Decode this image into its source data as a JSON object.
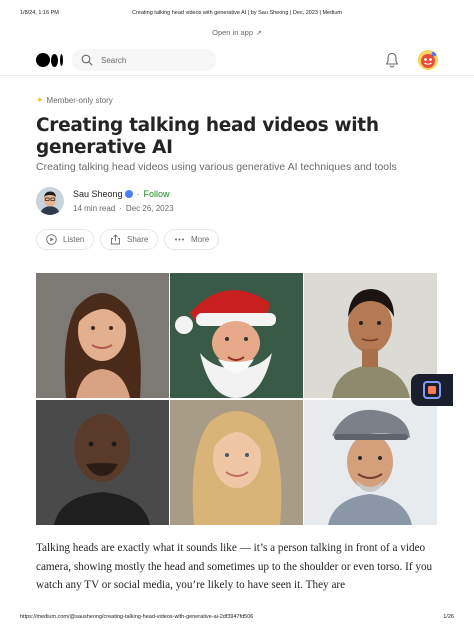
{
  "print_header": {
    "date": "1/8/24, 1:16 PM",
    "title": "Creating talking head videos with generative AI | by Sau Sheong | Dec, 2023 | Medium"
  },
  "open_in_app": {
    "label": "Open in app",
    "arrow": "↗"
  },
  "topbar": {
    "logo_icon": "medium-logo-icon",
    "search_placeholder": "Search",
    "bell_icon": "bell-icon"
  },
  "article": {
    "badge": "Member-only story",
    "title": "Creating talking head videos with generative AI",
    "subtitle": "Creating talking head videos using various generative AI techniques and tools",
    "author": "Sau Sheong",
    "follow": "Follow",
    "read_time": "14 min read",
    "date": "Dec 26, 2023",
    "actions": {
      "listen": "Listen",
      "share": "Share",
      "more": "More"
    },
    "body": "Talking heads are exactly what it sounds like — it’s a person talking in front of a video camera, showing mostly the head and sometimes up to the shoulder or even torso. If you watch any TV or social media, you’re likely to have seen it. They are"
  },
  "colors": {
    "accent_green": "#1a8917",
    "star_gold": "#ffc017",
    "text_primary": "#242424",
    "text_secondary": "#6b6b6b"
  },
  "print_footer": {
    "url": "https://medium.com/@sausheong/creating-talking-head-videos-with-generative-ai-2df3947fd506",
    "page": "1/26"
  }
}
